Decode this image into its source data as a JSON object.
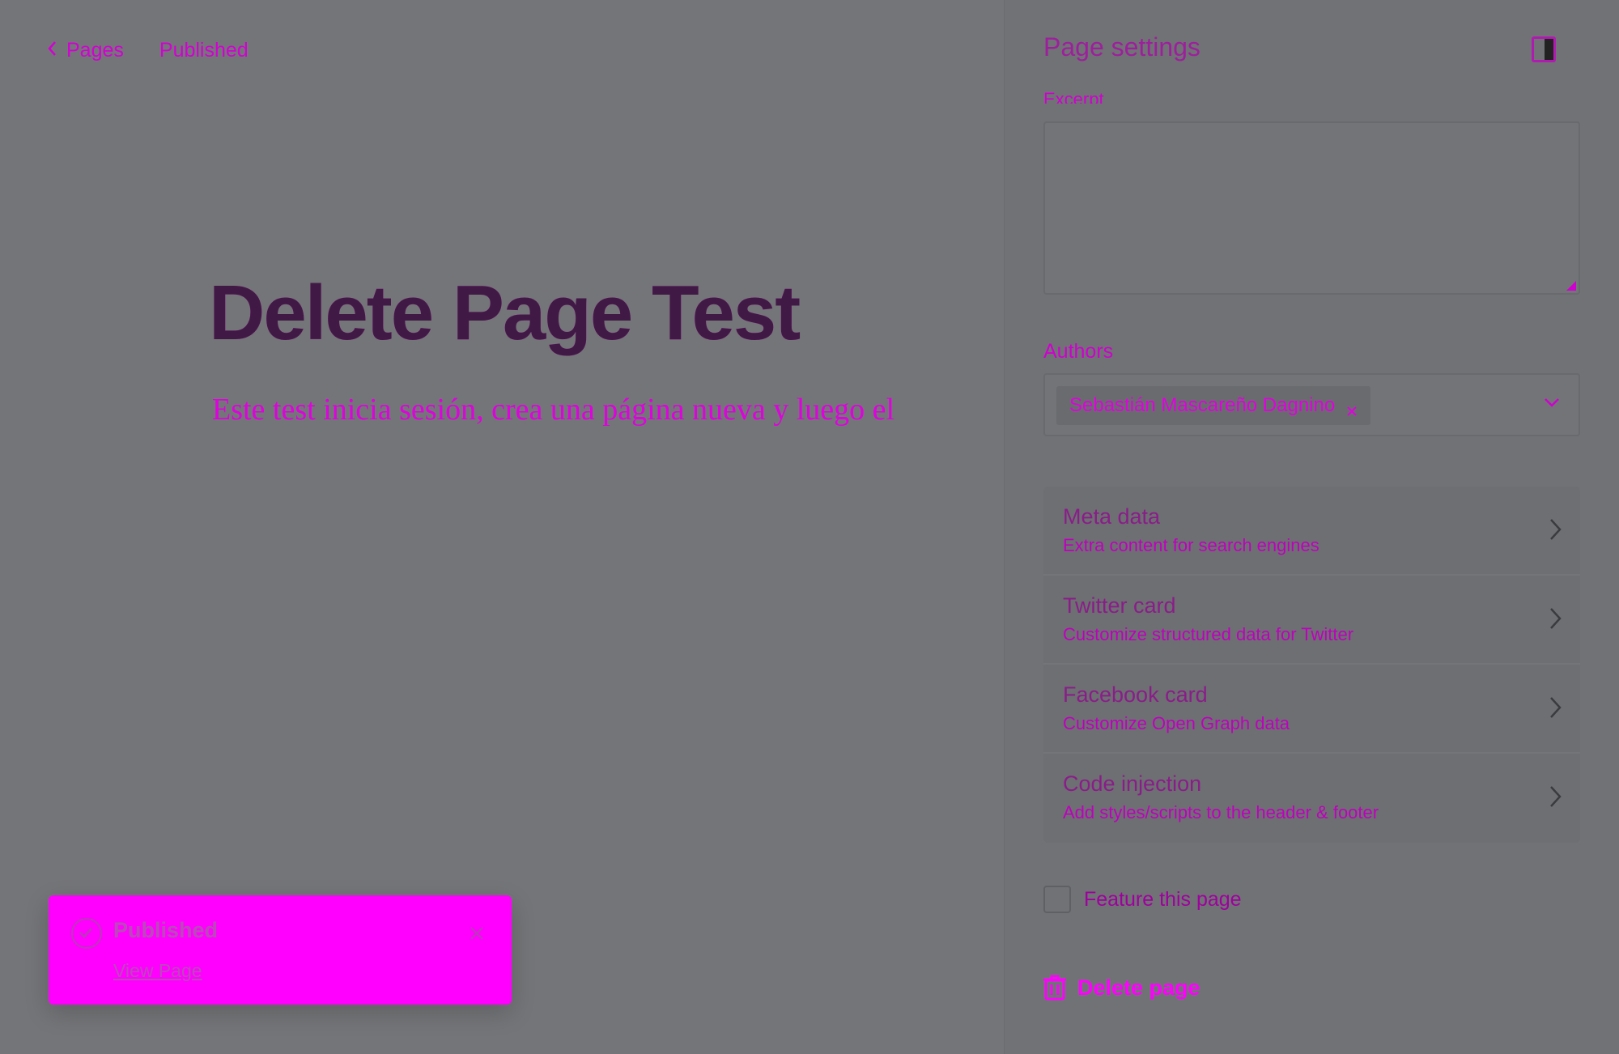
{
  "topbar": {
    "back_label": "Pages",
    "status": "Published"
  },
  "editor": {
    "title": "Delete Page Test",
    "excerpt": "Este test inicia sesión, crea una página nueva y luego el"
  },
  "toast": {
    "title": "Published",
    "link": "View Page"
  },
  "settings": {
    "title": "Page settings",
    "excerpt_label": "Excerpt",
    "excerpt_value": "",
    "authors_label": "Authors",
    "author": "Sebastián Mascareño Dagnino",
    "items": [
      {
        "title": "Meta data",
        "subtitle": "Extra content for search engines"
      },
      {
        "title": "Twitter card",
        "subtitle": "Customize structured data for Twitter"
      },
      {
        "title": "Facebook card",
        "subtitle": "Customize Open Graph data"
      },
      {
        "title": "Code injection",
        "subtitle": "Add styles/scripts to the header & footer"
      }
    ],
    "feature_label": "Feature this page",
    "delete_label": "Delete page"
  },
  "colors": {
    "accent": "#ff00ff",
    "background": "#747578",
    "panel": "#717275"
  },
  "icons": {
    "back": "chevron-left-icon",
    "toast": "check-circle-icon",
    "toast_close": "close-icon",
    "panel_toggle": "sidebar-toggle-icon",
    "chip_remove": "close-icon",
    "dropdown": "chevron-down-icon",
    "item_arrow": "chevron-right-icon",
    "delete": "trash-icon"
  }
}
